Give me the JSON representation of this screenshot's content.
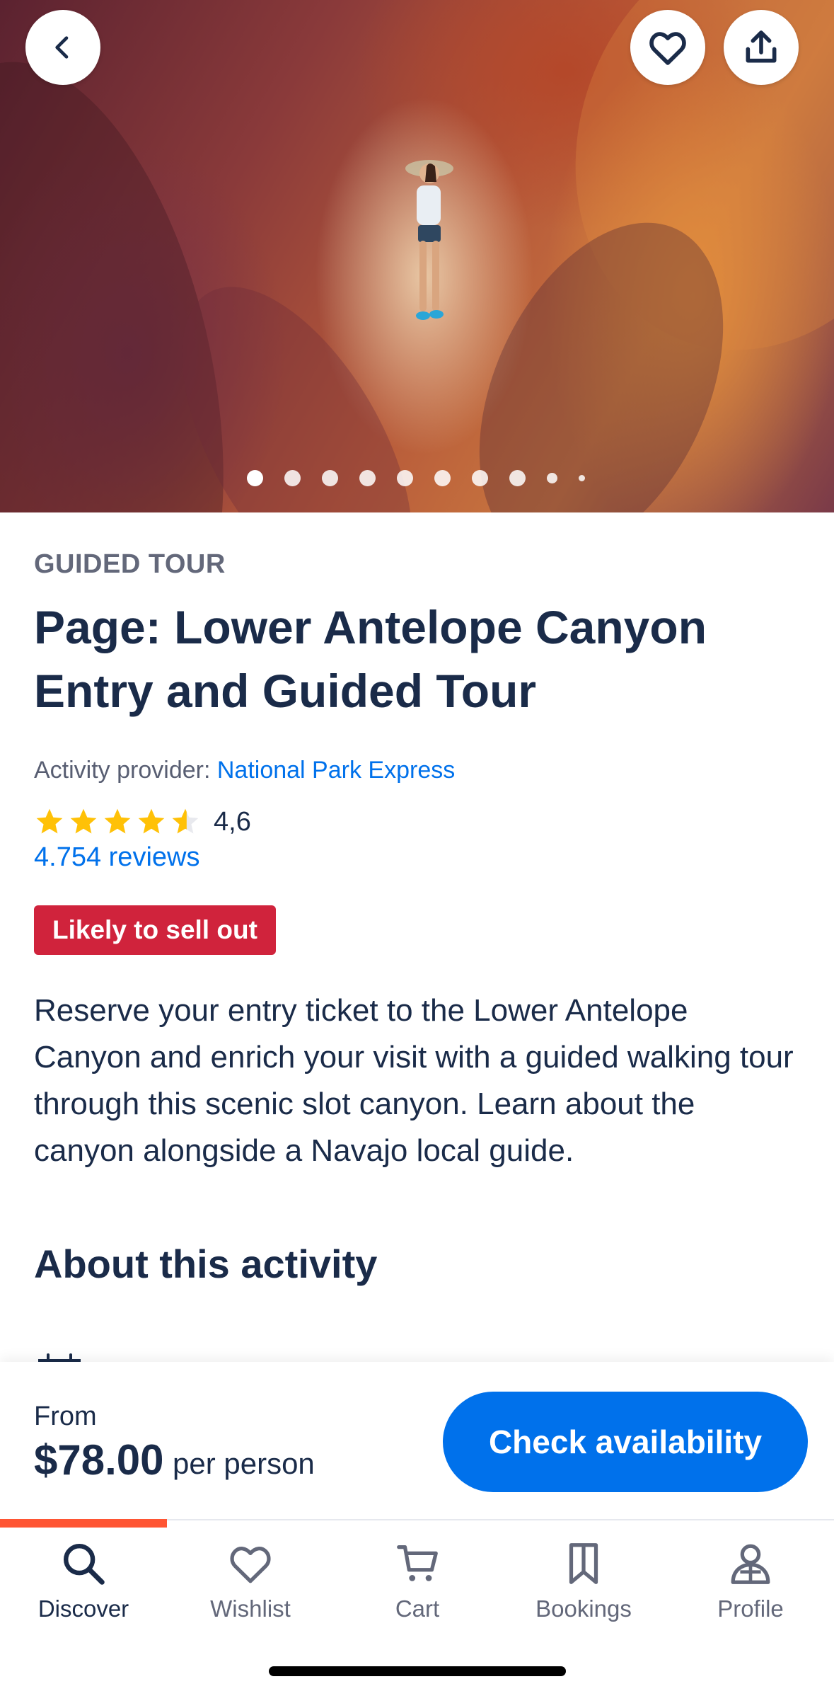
{
  "hero": {
    "back_icon": "chevron-left-icon",
    "wishlist_icon": "heart-icon",
    "share_icon": "share-icon",
    "photo_count": 10,
    "active_photo": 1
  },
  "activity": {
    "category": "GUIDED TOUR",
    "title": "Page: Lower Antelope Canyon Entry and Guided Tour",
    "provider_label": "Activity provider:",
    "provider_name": "National Park Express",
    "rating": "4,6",
    "rating_stars": 4.6,
    "reviews": "4.754 reviews",
    "badge": "Likely to sell out",
    "description": "Reserve your entry ticket to the Lower Antelope Canyon and enrich your visit with a guided walking tour through this scenic slot canyon. Learn about the canyon alongside a Navajo local guide.",
    "section_title": "About this activity"
  },
  "booking": {
    "from_label": "From",
    "price": "$78.00",
    "per_label": "per person",
    "cta_label": "Check availability"
  },
  "nav": {
    "items": [
      {
        "label": "Discover",
        "icon": "search-icon",
        "active": true
      },
      {
        "label": "Wishlist",
        "icon": "heart-icon",
        "active": false
      },
      {
        "label": "Cart",
        "icon": "cart-icon",
        "active": false
      },
      {
        "label": "Bookings",
        "icon": "bookmark-icon",
        "active": false
      },
      {
        "label": "Profile",
        "icon": "profile-icon",
        "active": false
      }
    ]
  },
  "colors": {
    "brand_blue": "#0071eb",
    "text_dark": "#1a2b49",
    "badge_red": "#d0233c",
    "nav_accent": "#ff5533",
    "star_yellow": "#ffc107"
  }
}
